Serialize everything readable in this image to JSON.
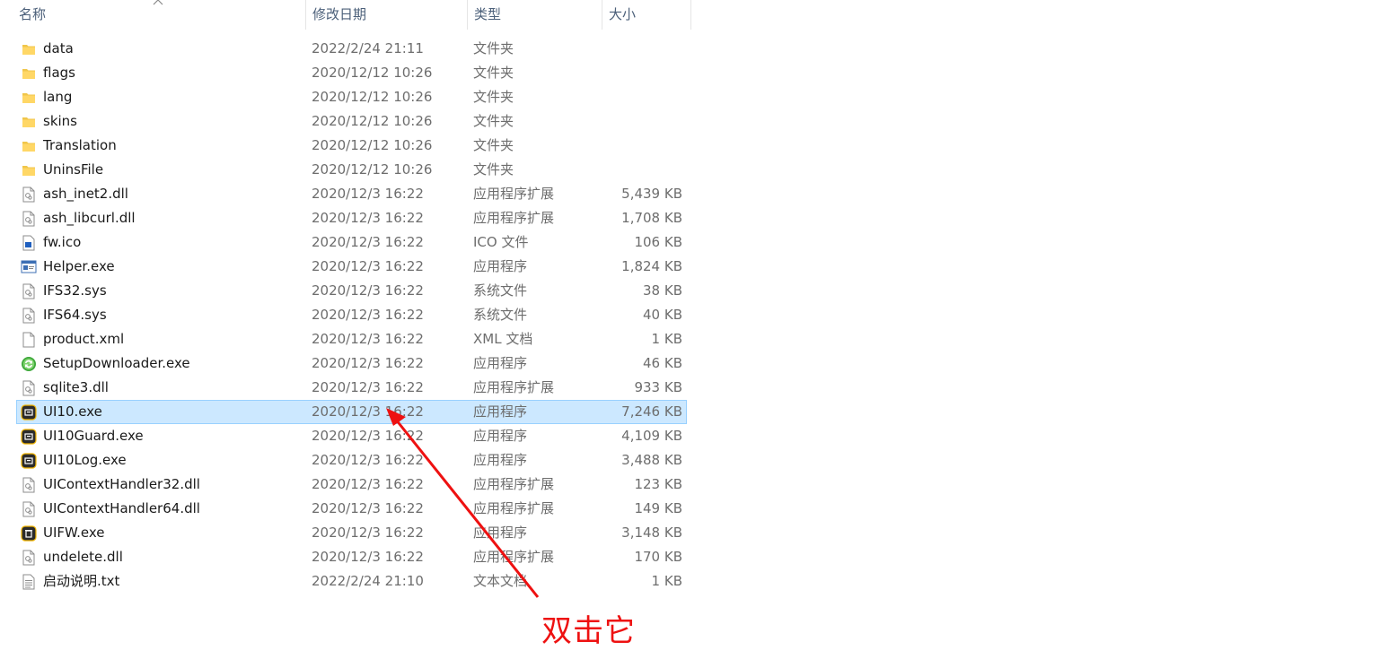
{
  "header": {
    "name": "名称",
    "date": "修改日期",
    "type": "类型",
    "size": "大小"
  },
  "colors": {
    "selection_bg": "#cce8ff",
    "selection_border": "#99d1ff",
    "folder": "#f0c64a",
    "annotation": "#ee1111"
  },
  "files": [
    {
      "icon": "folder-icon",
      "name": "data",
      "date": "2022/2/24 21:11",
      "type": "文件夹",
      "size": ""
    },
    {
      "icon": "folder-icon",
      "name": "flags",
      "date": "2020/12/12 10:26",
      "type": "文件夹",
      "size": ""
    },
    {
      "icon": "folder-icon",
      "name": "lang",
      "date": "2020/12/12 10:26",
      "type": "文件夹",
      "size": ""
    },
    {
      "icon": "folder-icon",
      "name": "skins",
      "date": "2020/12/12 10:26",
      "type": "文件夹",
      "size": ""
    },
    {
      "icon": "folder-icon",
      "name": "Translation",
      "date": "2020/12/12 10:26",
      "type": "文件夹",
      "size": ""
    },
    {
      "icon": "folder-icon",
      "name": "UninsFile",
      "date": "2020/12/12 10:26",
      "type": "文件夹",
      "size": ""
    },
    {
      "icon": "dll-icon",
      "name": "ash_inet2.dll",
      "date": "2020/12/3 16:22",
      "type": "应用程序扩展",
      "size": "5,439 KB"
    },
    {
      "icon": "dll-icon",
      "name": "ash_libcurl.dll",
      "date": "2020/12/3 16:22",
      "type": "应用程序扩展",
      "size": "1,708 KB"
    },
    {
      "icon": "ico-file-icon",
      "name": "fw.ico",
      "date": "2020/12/3 16:22",
      "type": "ICO 文件",
      "size": "106 KB"
    },
    {
      "icon": "app-window-icon",
      "name": "Helper.exe",
      "date": "2020/12/3 16:22",
      "type": "应用程序",
      "size": "1,824 KB"
    },
    {
      "icon": "dll-icon",
      "name": "IFS32.sys",
      "date": "2020/12/3 16:22",
      "type": "系统文件",
      "size": "38 KB"
    },
    {
      "icon": "dll-icon",
      "name": "IFS64.sys",
      "date": "2020/12/3 16:22",
      "type": "系统文件",
      "size": "40 KB"
    },
    {
      "icon": "blank-file-icon",
      "name": "product.xml",
      "date": "2020/12/3 16:22",
      "type": "XML 文档",
      "size": "1 KB"
    },
    {
      "icon": "green-refresh-icon",
      "name": "SetupDownloader.exe",
      "date": "2020/12/3 16:22",
      "type": "应用程序",
      "size": "46 KB"
    },
    {
      "icon": "dll-icon",
      "name": "sqlite3.dll",
      "date": "2020/12/3 16:22",
      "type": "应用程序扩展",
      "size": "933 KB"
    },
    {
      "icon": "dark-app-icon",
      "name": "UI10.exe",
      "date": "2020/12/3 16:22",
      "type": "应用程序",
      "size": "7,246 KB",
      "selected": true
    },
    {
      "icon": "dark-app-icon",
      "name": "UI10Guard.exe",
      "date": "2020/12/3 16:22",
      "type": "应用程序",
      "size": "4,109 KB"
    },
    {
      "icon": "dark-app-icon",
      "name": "UI10Log.exe",
      "date": "2020/12/3 16:22",
      "type": "应用程序",
      "size": "3,488 KB"
    },
    {
      "icon": "dll-icon",
      "name": "UIContextHandler32.dll",
      "date": "2020/12/3 16:22",
      "type": "应用程序扩展",
      "size": "123 KB"
    },
    {
      "icon": "dll-icon",
      "name": "UIContextHandler64.dll",
      "date": "2020/12/3 16:22",
      "type": "应用程序扩展",
      "size": "149 KB"
    },
    {
      "icon": "dark-trash-app-icon",
      "name": "UIFW.exe",
      "date": "2020/12/3 16:22",
      "type": "应用程序",
      "size": "3,148 KB"
    },
    {
      "icon": "dll-icon",
      "name": "undelete.dll",
      "date": "2020/12/3 16:22",
      "type": "应用程序扩展",
      "size": "170 KB"
    },
    {
      "icon": "text-file-icon",
      "name": "启动说明.txt",
      "date": "2022/2/24 21:10",
      "type": "文本文档",
      "size": "1 KB"
    }
  ],
  "annotation": {
    "text": "双击它"
  }
}
